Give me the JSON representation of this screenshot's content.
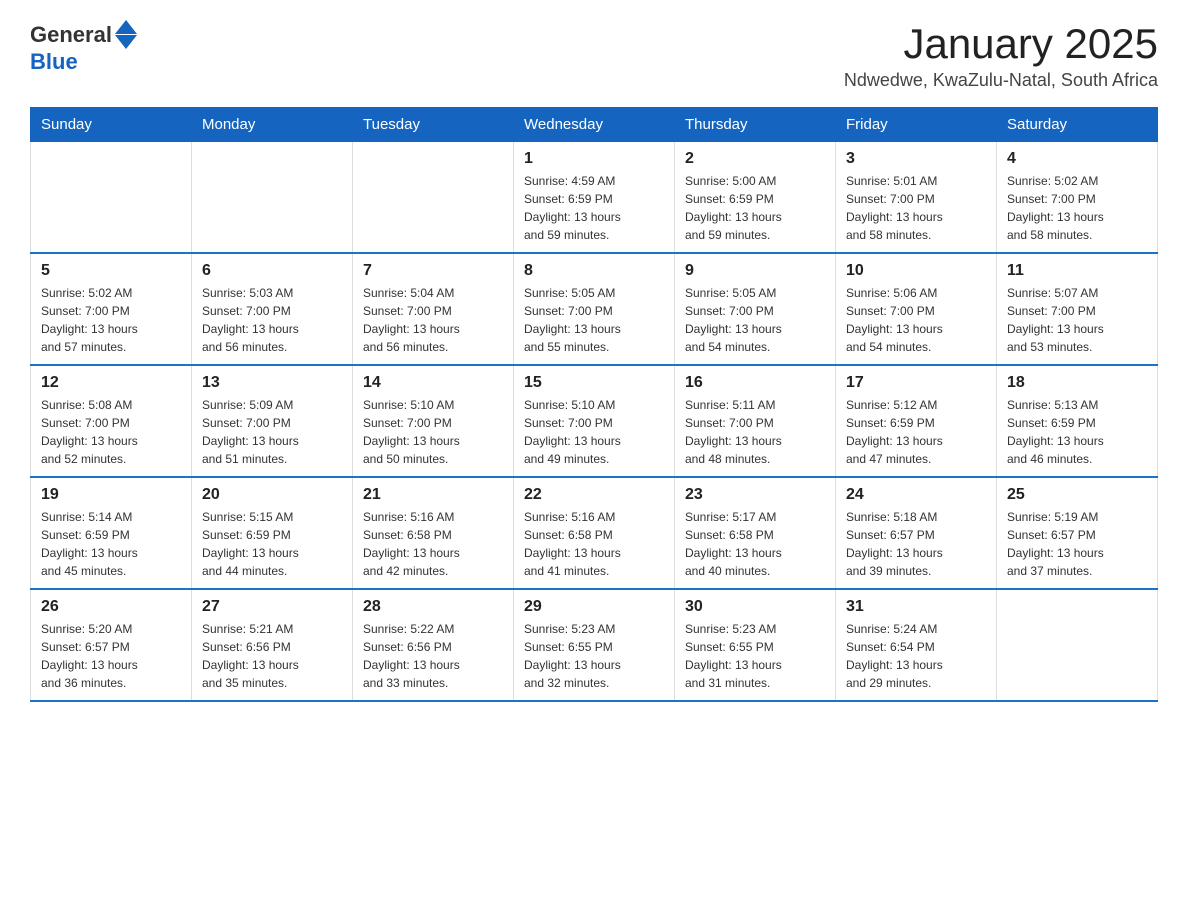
{
  "logo": {
    "general": "General",
    "blue": "Blue"
  },
  "header": {
    "title": "January 2025",
    "subtitle": "Ndwedwe, KwaZulu-Natal, South Africa"
  },
  "days_of_week": [
    "Sunday",
    "Monday",
    "Tuesday",
    "Wednesday",
    "Thursday",
    "Friday",
    "Saturday"
  ],
  "weeks": [
    [
      {
        "day": "",
        "info": ""
      },
      {
        "day": "",
        "info": ""
      },
      {
        "day": "",
        "info": ""
      },
      {
        "day": "1",
        "info": "Sunrise: 4:59 AM\nSunset: 6:59 PM\nDaylight: 13 hours\nand 59 minutes."
      },
      {
        "day": "2",
        "info": "Sunrise: 5:00 AM\nSunset: 6:59 PM\nDaylight: 13 hours\nand 59 minutes."
      },
      {
        "day": "3",
        "info": "Sunrise: 5:01 AM\nSunset: 7:00 PM\nDaylight: 13 hours\nand 58 minutes."
      },
      {
        "day": "4",
        "info": "Sunrise: 5:02 AM\nSunset: 7:00 PM\nDaylight: 13 hours\nand 58 minutes."
      }
    ],
    [
      {
        "day": "5",
        "info": "Sunrise: 5:02 AM\nSunset: 7:00 PM\nDaylight: 13 hours\nand 57 minutes."
      },
      {
        "day": "6",
        "info": "Sunrise: 5:03 AM\nSunset: 7:00 PM\nDaylight: 13 hours\nand 56 minutes."
      },
      {
        "day": "7",
        "info": "Sunrise: 5:04 AM\nSunset: 7:00 PM\nDaylight: 13 hours\nand 56 minutes."
      },
      {
        "day": "8",
        "info": "Sunrise: 5:05 AM\nSunset: 7:00 PM\nDaylight: 13 hours\nand 55 minutes."
      },
      {
        "day": "9",
        "info": "Sunrise: 5:05 AM\nSunset: 7:00 PM\nDaylight: 13 hours\nand 54 minutes."
      },
      {
        "day": "10",
        "info": "Sunrise: 5:06 AM\nSunset: 7:00 PM\nDaylight: 13 hours\nand 54 minutes."
      },
      {
        "day": "11",
        "info": "Sunrise: 5:07 AM\nSunset: 7:00 PM\nDaylight: 13 hours\nand 53 minutes."
      }
    ],
    [
      {
        "day": "12",
        "info": "Sunrise: 5:08 AM\nSunset: 7:00 PM\nDaylight: 13 hours\nand 52 minutes."
      },
      {
        "day": "13",
        "info": "Sunrise: 5:09 AM\nSunset: 7:00 PM\nDaylight: 13 hours\nand 51 minutes."
      },
      {
        "day": "14",
        "info": "Sunrise: 5:10 AM\nSunset: 7:00 PM\nDaylight: 13 hours\nand 50 minutes."
      },
      {
        "day": "15",
        "info": "Sunrise: 5:10 AM\nSunset: 7:00 PM\nDaylight: 13 hours\nand 49 minutes."
      },
      {
        "day": "16",
        "info": "Sunrise: 5:11 AM\nSunset: 7:00 PM\nDaylight: 13 hours\nand 48 minutes."
      },
      {
        "day": "17",
        "info": "Sunrise: 5:12 AM\nSunset: 6:59 PM\nDaylight: 13 hours\nand 47 minutes."
      },
      {
        "day": "18",
        "info": "Sunrise: 5:13 AM\nSunset: 6:59 PM\nDaylight: 13 hours\nand 46 minutes."
      }
    ],
    [
      {
        "day": "19",
        "info": "Sunrise: 5:14 AM\nSunset: 6:59 PM\nDaylight: 13 hours\nand 45 minutes."
      },
      {
        "day": "20",
        "info": "Sunrise: 5:15 AM\nSunset: 6:59 PM\nDaylight: 13 hours\nand 44 minutes."
      },
      {
        "day": "21",
        "info": "Sunrise: 5:16 AM\nSunset: 6:58 PM\nDaylight: 13 hours\nand 42 minutes."
      },
      {
        "day": "22",
        "info": "Sunrise: 5:16 AM\nSunset: 6:58 PM\nDaylight: 13 hours\nand 41 minutes."
      },
      {
        "day": "23",
        "info": "Sunrise: 5:17 AM\nSunset: 6:58 PM\nDaylight: 13 hours\nand 40 minutes."
      },
      {
        "day": "24",
        "info": "Sunrise: 5:18 AM\nSunset: 6:57 PM\nDaylight: 13 hours\nand 39 minutes."
      },
      {
        "day": "25",
        "info": "Sunrise: 5:19 AM\nSunset: 6:57 PM\nDaylight: 13 hours\nand 37 minutes."
      }
    ],
    [
      {
        "day": "26",
        "info": "Sunrise: 5:20 AM\nSunset: 6:57 PM\nDaylight: 13 hours\nand 36 minutes."
      },
      {
        "day": "27",
        "info": "Sunrise: 5:21 AM\nSunset: 6:56 PM\nDaylight: 13 hours\nand 35 minutes."
      },
      {
        "day": "28",
        "info": "Sunrise: 5:22 AM\nSunset: 6:56 PM\nDaylight: 13 hours\nand 33 minutes."
      },
      {
        "day": "29",
        "info": "Sunrise: 5:23 AM\nSunset: 6:55 PM\nDaylight: 13 hours\nand 32 minutes."
      },
      {
        "day": "30",
        "info": "Sunrise: 5:23 AM\nSunset: 6:55 PM\nDaylight: 13 hours\nand 31 minutes."
      },
      {
        "day": "31",
        "info": "Sunrise: 5:24 AM\nSunset: 6:54 PM\nDaylight: 13 hours\nand 29 minutes."
      },
      {
        "day": "",
        "info": ""
      }
    ]
  ]
}
